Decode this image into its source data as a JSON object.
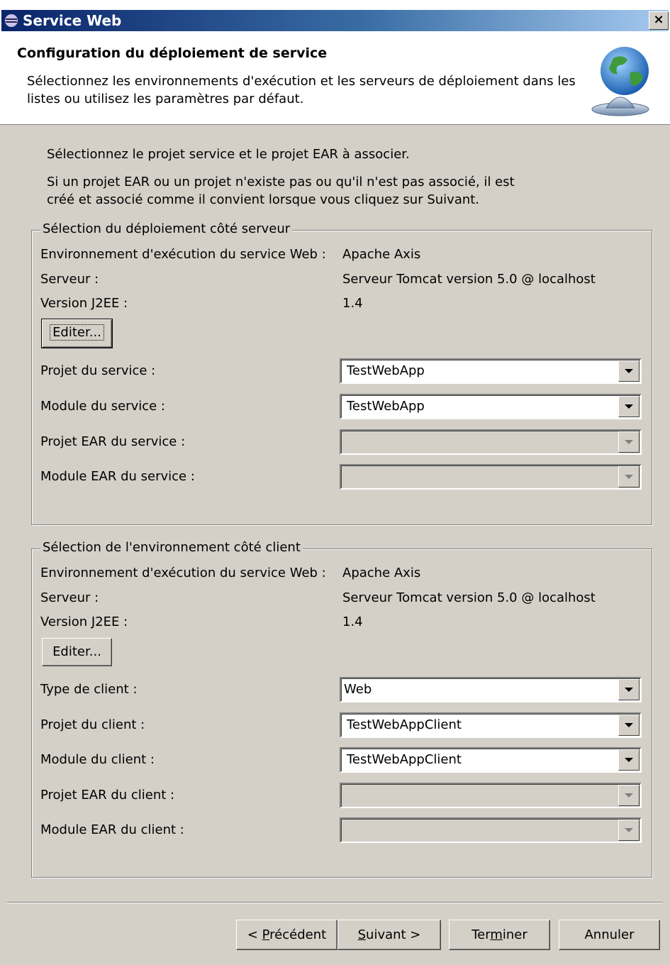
{
  "window": {
    "title": "Service Web",
    "close_label": "×"
  },
  "header": {
    "title": "Configuration du déploiement de service",
    "description": "Sélectionnez les environnements d'exécution et les serveurs de déploiement dans les listes ou utilisez les paramètres par défaut."
  },
  "intro": {
    "line1": "Sélectionnez le projet service et le projet EAR à associer.",
    "line2": "Si un projet EAR ou un projet n'existe pas ou qu'il n'est pas associé, il est créé et associé comme il convient lorsque vous cliquez sur Suivant."
  },
  "server_group": {
    "legend": "Sélection du déploiement côté serveur",
    "runtime_label": "Environnement d'exécution du service Web :",
    "runtime_value": "Apache Axis",
    "server_label": "Serveur :",
    "server_value": "Serveur Tomcat version 5.0 @ localhost",
    "j2ee_label": "Version J2EE :",
    "j2ee_value": "1.4",
    "edit_button": "Editer...",
    "service_project_label": "Projet du service :",
    "service_project_value": "TestWebApp",
    "service_module_label": "Module du service :",
    "service_module_value": "TestWebApp",
    "ear_project_label": "Projet EAR du service :",
    "ear_project_value": "",
    "ear_module_label": "Module EAR du service :",
    "ear_module_value": ""
  },
  "client_group": {
    "legend": "Sélection de l'environnement côté client",
    "runtime_label": "Environnement d'exécution du service Web :",
    "runtime_value": "Apache Axis",
    "server_label": "Serveur :",
    "server_value": "Serveur Tomcat version 5.0 @ localhost",
    "j2ee_label": "Version J2EE :",
    "j2ee_value": "1.4",
    "edit_button": "Editer...",
    "client_type_label": "Type de client :",
    "client_type_value": "Web",
    "client_project_label": "Projet du client :",
    "client_project_value": "TestWebAppClient",
    "client_module_label": "Module du client :",
    "client_module_value": "TestWebAppClient",
    "ear_project_label": "Projet EAR du client :",
    "ear_project_value": "",
    "ear_module_label": "Module EAR du client :",
    "ear_module_value": ""
  },
  "footer": {
    "back_pre": "< ",
    "back_key": "P",
    "back_post": "récédent",
    "next_key": "S",
    "next_post": "uivant >",
    "finish_pre": "Ter",
    "finish_key": "m",
    "finish_post": "iner",
    "cancel": "Annuler"
  }
}
